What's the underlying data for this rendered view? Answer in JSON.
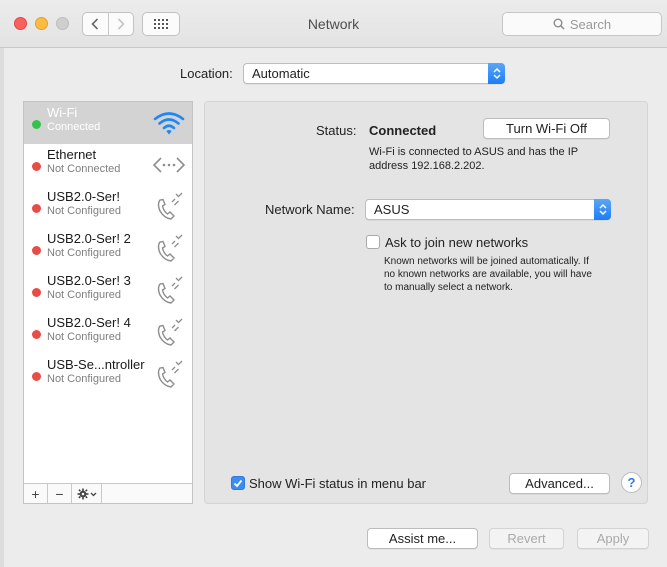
{
  "window": {
    "title": "Network",
    "search_placeholder": "Search"
  },
  "location": {
    "label": "Location:",
    "value": "Automatic"
  },
  "services": [
    {
      "name": "Wi-Fi",
      "status": "Connected",
      "dot": "#34c24b",
      "icon": "wifi-icon",
      "selected": true
    },
    {
      "name": "Ethernet",
      "status": "Not Connected",
      "dot": "#e74c47",
      "icon": "ethernet-icon"
    },
    {
      "name": "USB2.0-Ser!",
      "status": "Not Configured",
      "dot": "#e74c47",
      "icon": "phone-icon"
    },
    {
      "name": "USB2.0-Ser! 2",
      "status": "Not Configured",
      "dot": "#e74c47",
      "icon": "phone-icon"
    },
    {
      "name": "USB2.0-Ser! 3",
      "status": "Not Configured",
      "dot": "#e74c47",
      "icon": "phone-icon"
    },
    {
      "name": "USB2.0-Ser! 4",
      "status": "Not Configured",
      "dot": "#e74c47",
      "icon": "phone-icon"
    },
    {
      "name": "USB-Se...ntroller",
      "status": "Not Configured",
      "dot": "#e74c47",
      "icon": "phone-icon"
    }
  ],
  "sidebar_tools": {
    "add": "+",
    "remove": "−"
  },
  "detail": {
    "status_label": "Status:",
    "status_value": "Connected",
    "turn_off_button": "Turn Wi-Fi Off",
    "status_desc_line1": "Wi-Fi is connected to ASUS and has the IP",
    "status_desc_line2": "address 192.168.2.202.",
    "network_name_label": "Network Name:",
    "network_name_value": "ASUS",
    "ask_join_label": "Ask to join new networks",
    "ask_join_checked": false,
    "ask_desc_line1": "Known networks will be joined automatically. If",
    "ask_desc_line2": "no known networks are available, you will have",
    "ask_desc_line3": "to manually select a network.",
    "show_status_label": "Show Wi-Fi status in menu bar",
    "show_status_checked": true,
    "advanced_button": "Advanced...",
    "help_button": "?"
  },
  "footer": {
    "assist_button": "Assist me...",
    "revert_button": "Revert",
    "apply_button": "Apply"
  },
  "colors": {
    "accent": "#1c7df3",
    "connected": "#34c24b",
    "disconnected": "#e74c47"
  }
}
